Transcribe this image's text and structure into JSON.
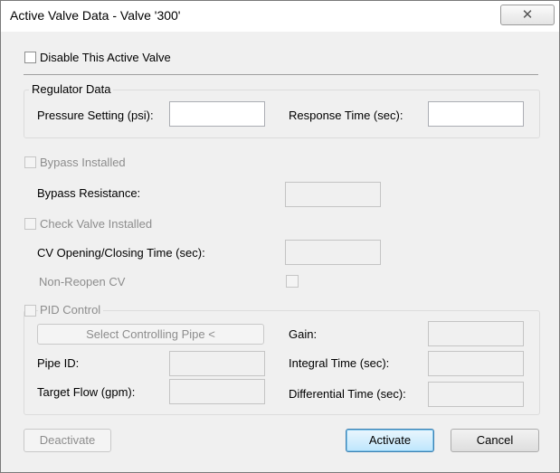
{
  "window": {
    "title": "Active Valve Data - Valve '300'",
    "close_glyph": "✕"
  },
  "disable_checkbox": {
    "label": "Disable This Active Valve",
    "checked": false
  },
  "regulator": {
    "group_label": "Regulator Data",
    "pressure_label": "Pressure Setting (psi):",
    "pressure_value": "",
    "response_label": "Response Time (sec):",
    "response_value": ""
  },
  "bypass": {
    "installed_label": "Bypass Installed",
    "resistance_label": "Bypass Resistance:",
    "resistance_value": ""
  },
  "check_valve": {
    "installed_label": "Check Valve Installed",
    "cv_time_label": "CV Opening/Closing Time (sec):",
    "cv_time_value": "",
    "non_reopen_label": "Non-Reopen CV"
  },
  "pid": {
    "label": "PID Control",
    "select_pipe_button": "Select Controlling Pipe <",
    "pipe_id_label": "Pipe ID:",
    "pipe_id_value": "",
    "target_flow_label": "Target Flow (gpm):",
    "target_flow_value": "",
    "gain_label": "Gain:",
    "gain_value": "",
    "integral_label": "Integral Time (sec):",
    "integral_value": "",
    "differential_label": "Differential Time (sec):",
    "differential_value": ""
  },
  "buttons": {
    "deactivate": "Deactivate",
    "activate": "Activate",
    "cancel": "Cancel"
  },
  "colors": {
    "disabled_text": "#8d8d8d",
    "default_button_border": "#3c7fb1"
  }
}
